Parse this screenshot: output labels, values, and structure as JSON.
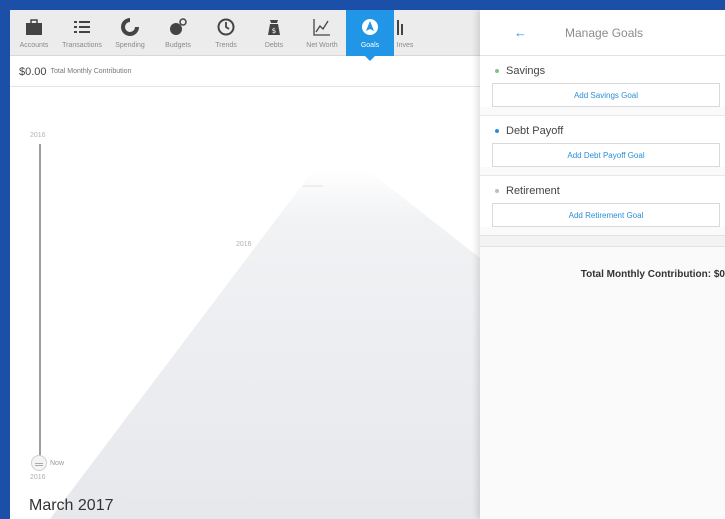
{
  "nav": {
    "items": [
      {
        "label": "Accounts",
        "icon": "briefcase-icon"
      },
      {
        "label": "Transactions",
        "icon": "list-icon"
      },
      {
        "label": "Spending",
        "icon": "pie-icon"
      },
      {
        "label": "Budgets",
        "icon": "budget-icon"
      },
      {
        "label": "Trends",
        "icon": "clock-icon"
      },
      {
        "label": "Debts",
        "icon": "debt-bag-icon"
      },
      {
        "label": "Net Worth",
        "icon": "line-graph-icon"
      },
      {
        "label": "Goals",
        "icon": "compass-icon",
        "active": true
      },
      {
        "label": "Inves",
        "icon": "bar-chart-icon"
      }
    ]
  },
  "contribution": {
    "amount": "$0.00",
    "label": "Total Monthly Contribution"
  },
  "timeline": {
    "top_year": "2016",
    "mid_year": "2016",
    "now_label": "Now",
    "bottom_year": "2016",
    "month": "March 2017"
  },
  "panel": {
    "back_icon": "back-arrow-icon",
    "title": "Manage Goals",
    "sections": [
      {
        "title": "Savings",
        "button": "Add Savings Goal",
        "color": "#7ec77e"
      },
      {
        "title": "Debt Payoff",
        "button": "Add Debt Payoff Goal",
        "color": "#2f8fd6"
      },
      {
        "title": "Retirement",
        "button": "Add Retirement Goal",
        "color": "#bdbdbd"
      }
    ],
    "total_label": "Total Monthly Contribution:",
    "total_value": "$0"
  },
  "colors": {
    "accent": "#2196e6",
    "frame": "#1b4fa8"
  }
}
